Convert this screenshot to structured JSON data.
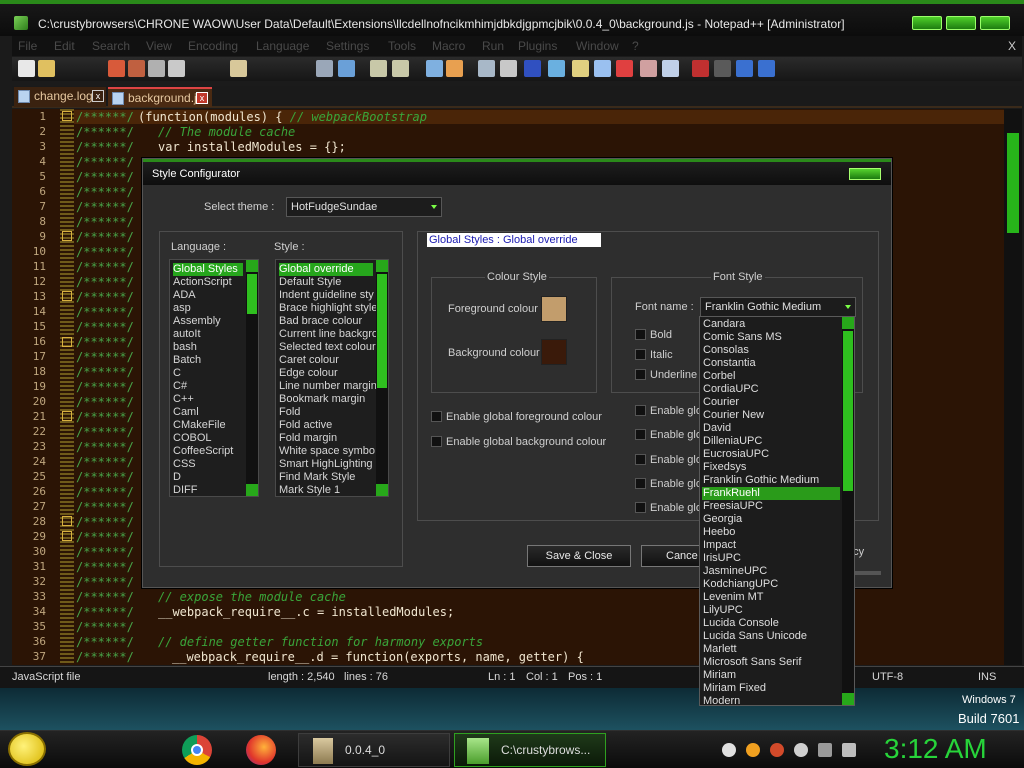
{
  "window": {
    "title": "C:\\crustybrowsers\\CHRONE WAOW\\User Data\\Default\\Extensions\\llcdellnofncikmhimjdbkdjgpmcjbik\\0.0.4_0\\background.js - Notepad++ [Administrator]"
  },
  "menu": [
    "File",
    "Edit",
    "Search",
    "View",
    "Encoding",
    "Language",
    "Settings",
    "Tools",
    "Macro",
    "Run",
    "Plugins",
    "Window",
    "?"
  ],
  "menu_close": "X",
  "tabs": [
    {
      "label": "change.log",
      "close": "x"
    },
    {
      "label": "background.js",
      "close": "x"
    }
  ],
  "editor": {
    "line_numbers": [
      "1",
      "2",
      "3",
      "4",
      "5",
      "6",
      "7",
      "8",
      "9",
      "10",
      "11",
      "12",
      "13",
      "14",
      "15",
      "16",
      "17",
      "18",
      "19",
      "20",
      "21",
      "22",
      "23",
      "24",
      "25",
      "26",
      "27",
      "28",
      "29",
      "30",
      "31",
      "32",
      "33",
      "34",
      "35",
      "36",
      "37"
    ],
    "prefix": "/******/",
    "line1_code": "(function(modules) { ",
    "line1_comment": "// webpackBootstrap",
    "line2_comment": "// The module cache",
    "line3_code": "var installedModules = {};",
    "line33_comment": "// expose the module cache",
    "line34_code": "__webpack_require__.c = installedModules;",
    "line36_comment": "// define getter function for harmony exports",
    "line37_code": "__webpack_require__.d = function(exports, name, getter) {"
  },
  "status": {
    "filetype": "JavaScript file",
    "length": "length : 2,540",
    "lines": "lines : 76",
    "ln": "Ln : 1",
    "col": "Col : 1",
    "pos": "Pos : 1",
    "encoding": "UTF-8",
    "ins": "INS"
  },
  "desktop": {
    "windows_label": "Windows 7",
    "build": "Build 7601"
  },
  "taskbar": {
    "folder_button": "0.0.4_0",
    "npp_button": "C:\\crustybrows...",
    "clock": "3:12 AM"
  },
  "dialog": {
    "title": "Style Configurator",
    "select_theme_label": "Select theme :",
    "theme_value": "HotFudgeSundae",
    "language_label": "Language :",
    "style_label": "Style :",
    "languages": [
      "Global Styles",
      "ActionScript",
      "ADA",
      "asp",
      "Assembly",
      "autoIt",
      "bash",
      "Batch",
      "C",
      "C#",
      "C++",
      "Caml",
      "CMakeFile",
      "COBOL",
      "CoffeeScript",
      "CSS",
      "D",
      "DIFF"
    ],
    "styles": [
      "Global override",
      "Default Style",
      "Indent guideline sty",
      "Brace highlight style",
      "Bad brace colour",
      "Current line backgro",
      "Selected text colour",
      "Caret colour",
      "Edge colour",
      "Line number margin",
      "Bookmark margin",
      "Fold",
      "Fold active",
      "Fold margin",
      "White space symbo",
      "Smart HighLighting",
      "Find Mark Style",
      "Mark Style 1"
    ],
    "style_header": "Global Styles : Global override",
    "colour_style_label": "Colour Style",
    "foreground_label": "Foreground colour",
    "background_label": "Background colour",
    "foreground_color": "#c29d6c",
    "background_color": "#3a1a0a",
    "font_style_label": "Font Style",
    "font_name_label": "Font name :",
    "font_value": "Franklin Gothic Medium",
    "bold_label": "Bold",
    "italic_label": "Italic",
    "underline_label": "Underline",
    "enable_fg_label": "Enable global foreground colour",
    "enable_bg_label": "Enable global background colour",
    "enable_glo_label": "Enable glo",
    "save_close": "Save & Close",
    "cancel": "Cance",
    "transparency_partial": "ncy"
  },
  "font_list": [
    "Candara",
    "Comic Sans MS",
    "Consolas",
    "Constantia",
    "Corbel",
    "CordiaUPC",
    "Courier",
    "Courier New",
    "David",
    "DilleniaUPC",
    "EucrosiaUPC",
    "Fixedsys",
    "Franklin Gothic Medium",
    "FrankRuehl",
    "FreesiaUPC",
    "Georgia",
    "Heebo",
    "Impact",
    "IrisUPC",
    "JasmineUPC",
    "KodchiangUPC",
    "Levenim MT",
    "LilyUPC",
    "Lucida Console",
    "Lucida Sans Unicode",
    "Marlett",
    "Microsoft Sans Serif",
    "Miriam",
    "Miriam Fixed",
    "Modern"
  ],
  "font_list_selected": "FrankRuehl",
  "colors": {
    "accent_green": "#27d43a",
    "editor_bg": "#2b1405",
    "selection_green": "#26a61c"
  }
}
